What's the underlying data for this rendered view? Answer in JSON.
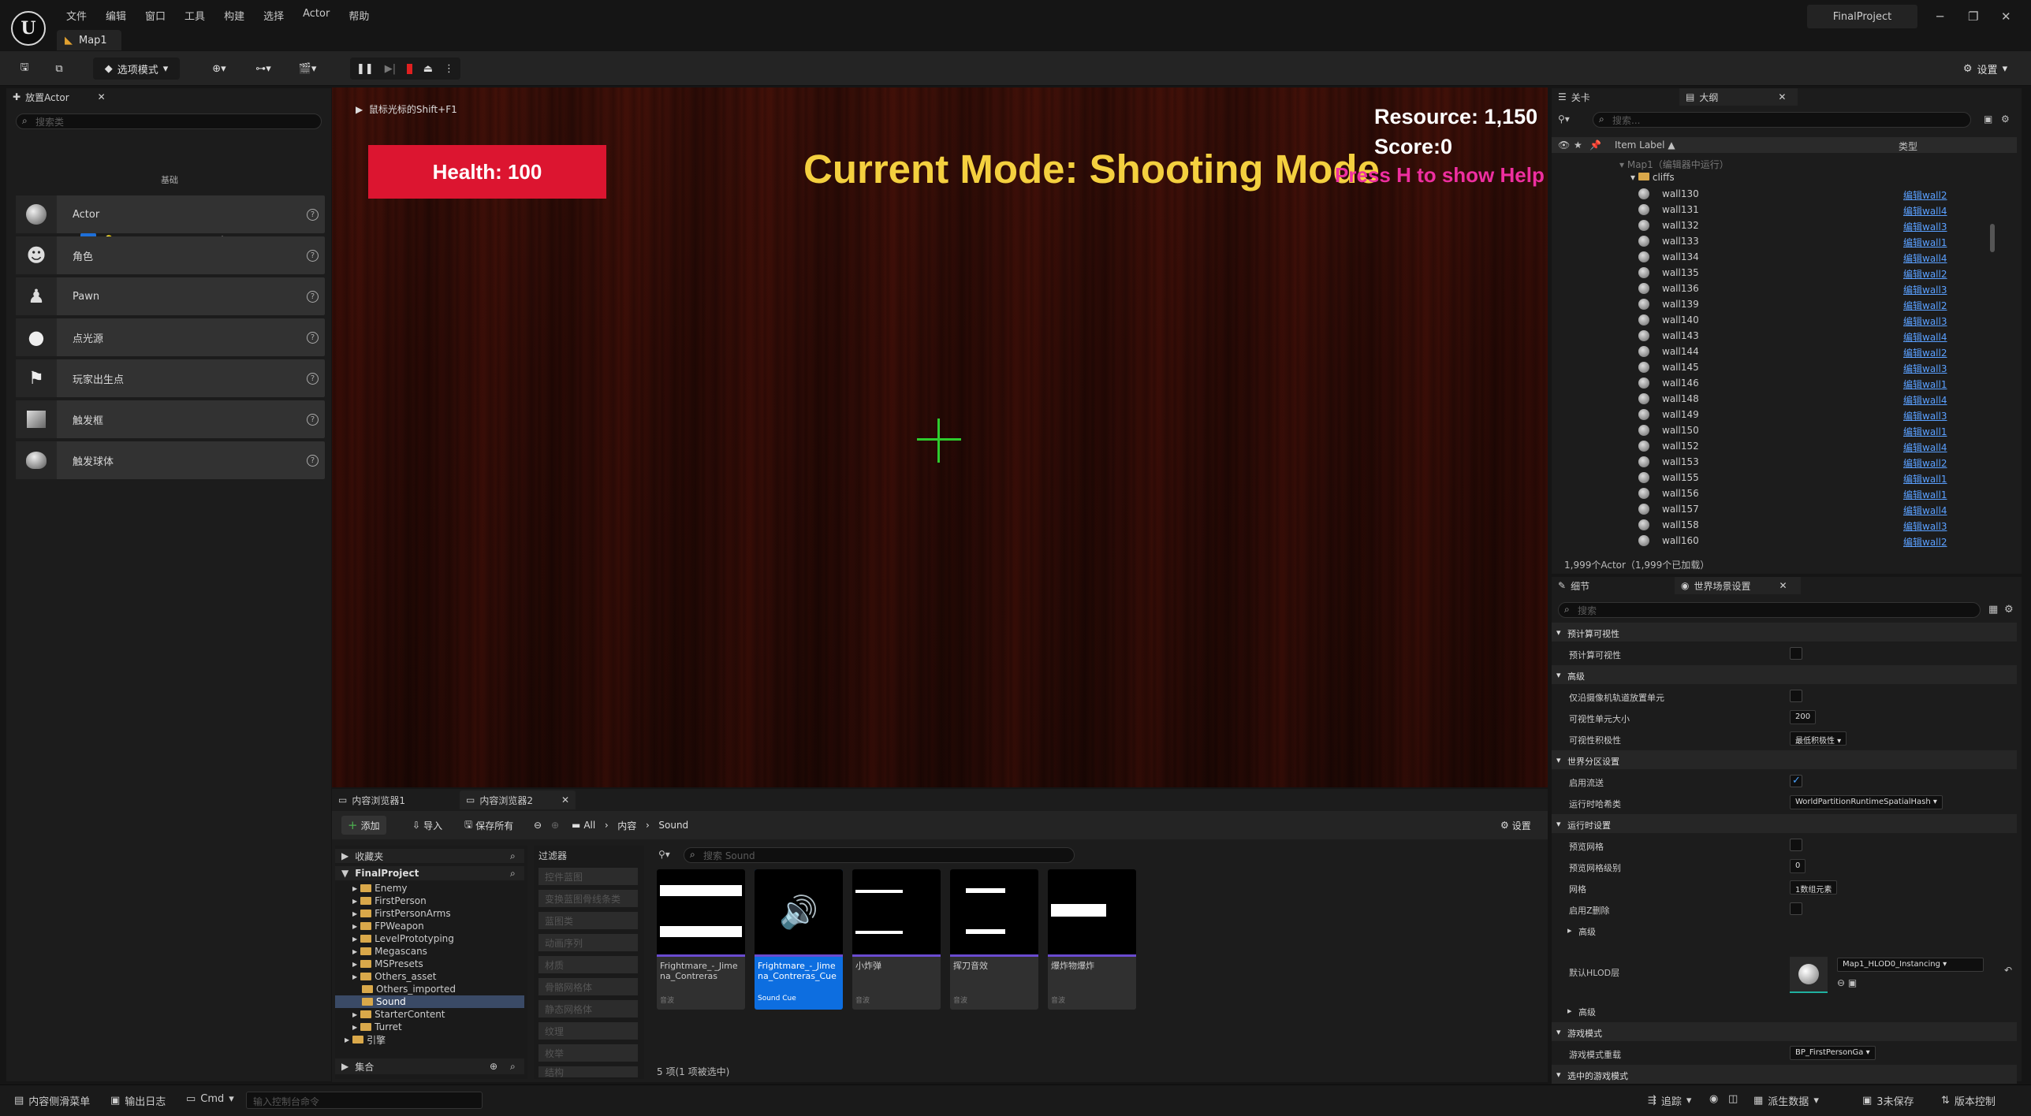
{
  "menu": [
    "文件",
    "编辑",
    "窗口",
    "工具",
    "构建",
    "选择",
    "Actor",
    "帮助"
  ],
  "map_tab": "Map1",
  "project_name": "FinalProject",
  "toolbar": {
    "mode_label": "选项模式",
    "settings_label": "设置"
  },
  "place_actors": {
    "tab_label": "放置Actor",
    "search_placeholder": "搜索类",
    "category": "基础",
    "items": [
      "Actor",
      "角色",
      "Pawn",
      "点光源",
      "玩家出生点",
      "触发框",
      "触发球体"
    ]
  },
  "viewport": {
    "shift_hint": "鼠标光标的Shift+F1",
    "health": "Health: 100",
    "mode": "Current Mode: Shooting Mode",
    "resource": "Resource: 1,150",
    "score": "Score:0",
    "help": "Press H to show Help"
  },
  "content_browser": {
    "tab1": "内容浏览器1",
    "tab2": "内容浏览器2",
    "add": "添加",
    "import": "导入",
    "save_all": "保存所有",
    "breadcrumb": [
      "All",
      "内容",
      "Sound"
    ],
    "settings": "设置",
    "favorites": "收藏夹",
    "root": "FinalProject",
    "folders": [
      "Enemy",
      "FirstPerson",
      "FirstPersonArms",
      "FPWeapon",
      "LevelPrototyping",
      "Megascans",
      "MSPresets",
      "Others_asset",
      "Others_imported",
      "Sound",
      "StarterContent",
      "Turret"
    ],
    "engine": "引擎",
    "collections": "集合",
    "filters_label": "过滤器",
    "filters": [
      "控件蓝图",
      "变换蓝图骨线条类",
      "蓝图类",
      "动画序列",
      "材质",
      "骨骼网格体",
      "静态网格体",
      "纹理",
      "枚举",
      "结构"
    ],
    "search_placeholder": "搜索 Sound",
    "assets": [
      {
        "name": "Frightmare_-_Jimena_Contreras",
        "type": "音波"
      },
      {
        "name": "Frightmare_-_Jimena_Contreras_Cue",
        "type": "Sound Cue"
      },
      {
        "name": "小炸弹",
        "type": "音波"
      },
      {
        "name": "挥刀音效",
        "type": "音波"
      },
      {
        "name": "爆炸物爆炸",
        "type": "音波"
      }
    ],
    "status": "5 项(1 项被选中)"
  },
  "outliner": {
    "tab_level": "关卡",
    "tab_outliner": "大纲",
    "search_placeholder": "搜索...",
    "col_label": "Item Label ▲",
    "col_type": "类型",
    "map_row": "Map1（编辑器中运行）",
    "folder": "cliffs",
    "rows": [
      {
        "name": "wall130",
        "type": "编辑wall2"
      },
      {
        "name": "wall131",
        "type": "编辑wall4"
      },
      {
        "name": "wall132",
        "type": "编辑wall3"
      },
      {
        "name": "wall133",
        "type": "编辑wall1"
      },
      {
        "name": "wall134",
        "type": "编辑wall4"
      },
      {
        "name": "wall135",
        "type": "编辑wall2"
      },
      {
        "name": "wall136",
        "type": "编辑wall3"
      },
      {
        "name": "wall139",
        "type": "编辑wall2"
      },
      {
        "name": "wall140",
        "type": "编辑wall3"
      },
      {
        "name": "wall143",
        "type": "编辑wall4"
      },
      {
        "name": "wall144",
        "type": "编辑wall2"
      },
      {
        "name": "wall145",
        "type": "编辑wall3"
      },
      {
        "name": "wall146",
        "type": "编辑wall1"
      },
      {
        "name": "wall148",
        "type": "编辑wall4"
      },
      {
        "name": "wall149",
        "type": "编辑wall3"
      },
      {
        "name": "wall150",
        "type": "编辑wall1"
      },
      {
        "name": "wall152",
        "type": "编辑wall4"
      },
      {
        "name": "wall153",
        "type": "编辑wall2"
      },
      {
        "name": "wall155",
        "type": "编辑wall1"
      },
      {
        "name": "wall156",
        "type": "编辑wall1"
      },
      {
        "name": "wall157",
        "type": "编辑wall4"
      },
      {
        "name": "wall158",
        "type": "编辑wall3"
      },
      {
        "name": "wall160",
        "type": "编辑wall2"
      }
    ],
    "count": "1,999个Actor（1,999个已加载）"
  },
  "details": {
    "tab_details": "细节",
    "tab_world": "世界场景设置",
    "search_placeholder": "搜索",
    "rows": [
      {
        "label": "预计算可视性",
        "kind": "section"
      },
      {
        "label": "预计算可视性",
        "kind": "check",
        "on": false
      },
      {
        "label": "高级",
        "kind": "section"
      },
      {
        "label": "仅沿摄像机轨道放置单元",
        "kind": "check",
        "on": false
      },
      {
        "label": "可视性单元大小",
        "kind": "value",
        "value": "200"
      },
      {
        "label": "可视性积极性",
        "kind": "value",
        "value": "最低积极性 ▾"
      },
      {
        "label": "世界分区设置",
        "kind": "section"
      },
      {
        "label": "启用流送",
        "kind": "check",
        "on": true
      },
      {
        "label": "运行时哈希类",
        "kind": "value",
        "value": "WorldPartitionRuntimeSpatialHash ▾"
      },
      {
        "label": "运行时设置",
        "kind": "section"
      },
      {
        "label": "预览网格",
        "kind": "check",
        "on": false
      },
      {
        "label": "预览网格级别",
        "kind": "value",
        "value": "0"
      },
      {
        "label": "网格",
        "kind": "value",
        "value": "1数组元素"
      },
      {
        "label": "启用Z删除",
        "kind": "check",
        "on": false
      },
      {
        "label": "高级",
        "kind": "sub"
      }
    ],
    "hlod_label": "默认HLOD层",
    "hlod_value": "Map1_HLOD0_Instancing",
    "rows2": [
      {
        "label": "高级",
        "kind": "sub"
      },
      {
        "label": "游戏模式",
        "kind": "section"
      },
      {
        "label": "游戏模式重载",
        "kind": "value",
        "value": "BP_FirstPersonGa ▾"
      },
      {
        "label": "选中的游戏模式",
        "kind": "section"
      }
    ]
  },
  "statusbar": {
    "drawer": "内容侧滑菜单",
    "output_log": "输出日志",
    "cmd": "Cmd",
    "console_placeholder": "输入控制台命令",
    "trace": "追踪",
    "derived": "派生数据",
    "unsaved": "3未保存",
    "version": "版本控制"
  }
}
